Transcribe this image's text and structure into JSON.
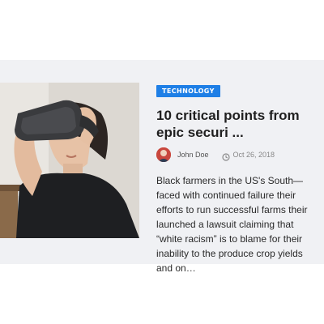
{
  "post": {
    "category": "TECHNOLOGY",
    "title": "10 critical points from epic securi ...",
    "author": "John Doe",
    "date": "Oct 26, 2018",
    "excerpt": "Black farmers in the US's South— faced with continued failure their efforts to run successful farms their launched a lawsuit claiming that “white racism” is to blame for their inability to the produce crop yields and on…",
    "thumbnail_subject": "person-wearing-vr-headset",
    "icons": {
      "date": "clock-icon"
    }
  },
  "colors": {
    "badge": "#1e7fe6",
    "card_background": "#f0f1f4",
    "title": "#1f1f1f"
  }
}
